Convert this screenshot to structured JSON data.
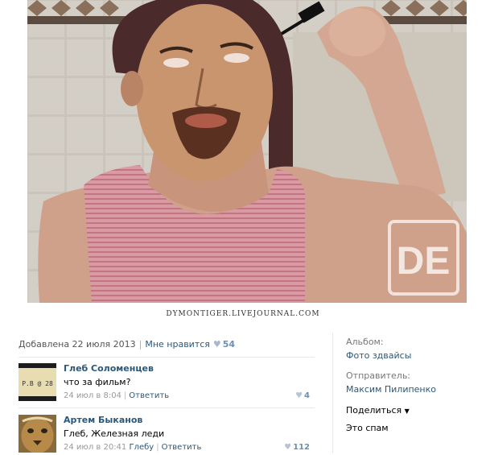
{
  "watermark": {
    "caption": "DYMONTIGER.LIVEJOURNAL.COM",
    "logo": "DE"
  },
  "meta": {
    "added": "Добавлена 22 июля 2013",
    "like_label": "Мне нравится",
    "likes": "54"
  },
  "comments": [
    {
      "author": "Глеб Соломенцев",
      "text": "что за фильм?",
      "time": "24 июл в 8:04",
      "reply_to": "",
      "reply": "Ответить",
      "likes": "4",
      "avatar_text": "P.B @ 28"
    },
    {
      "author": "Артем Быканов",
      "text": "Глеб, Железная леди",
      "time": "24 июл в 20:41",
      "reply_to": "Глебу",
      "reply": "Ответить",
      "likes": "112"
    }
  ],
  "sidebar": {
    "album_label": "Альбом:",
    "album_value": "Фото здвайсы",
    "sender_label": "Отправитель:",
    "sender_value": "Максим Пилипенко",
    "share": "Поделиться",
    "spam": "Это спам"
  },
  "colors": {
    "link": "#2b587a",
    "heart": "#a8b8cc"
  }
}
